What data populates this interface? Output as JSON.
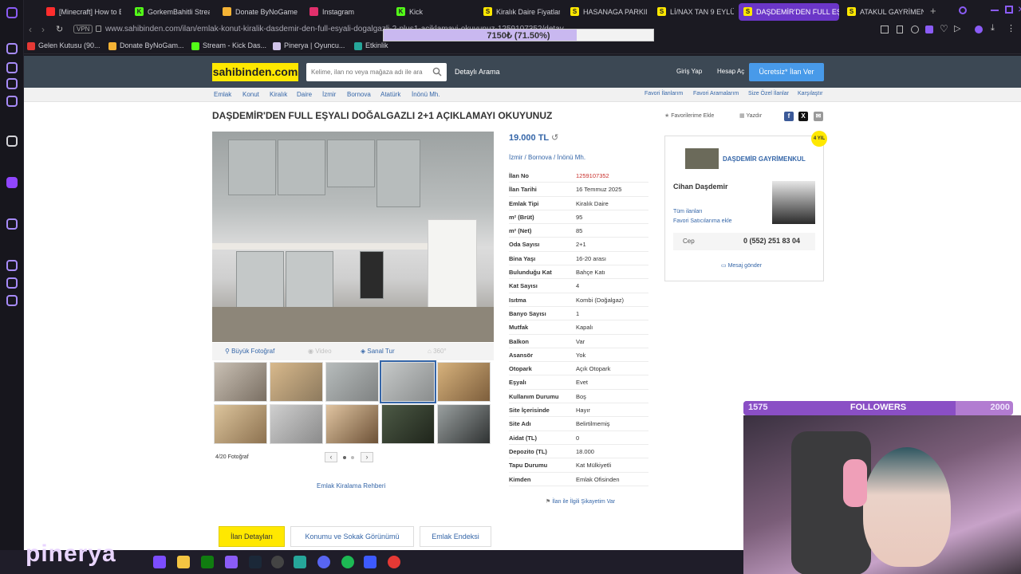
{
  "browser": {
    "tabs": [
      {
        "label": "[Minecraft] How to B",
        "color": "#ff2d2d"
      },
      {
        "label": "GorkemBahitli Strea",
        "color": "#53fc18"
      },
      {
        "label": "Donate ByNoGame",
        "color": "#f5b335"
      },
      {
        "label": "Instagram",
        "color": "#e1306c"
      },
      {
        "label": "Kick",
        "color": "#53fc18"
      },
      {
        "label": "Kiralık Daire Fiyatlar",
        "color": "#ffe800"
      },
      {
        "label": "HASANAGA PARKIN",
        "color": "#ffe800"
      },
      {
        "label": "Lİ/NAX TAN 9 EYLÜ",
        "color": "#ffe800"
      },
      {
        "label": "DAŞDEMİR'DEN FULL EŞ",
        "color": "#ffe800"
      },
      {
        "label": "ATAKUL GAYRİMENK",
        "color": "#ffe800"
      }
    ],
    "tab_letters": [
      "",
      "K",
      "",
      "",
      "K",
      "S",
      "S",
      "S",
      "S",
      "S"
    ],
    "vpn": "VPN",
    "url": "www.sahibinden.com/ilan/emlak-konut-kiralik-dasdemir-den-full-esyali-dogalgazli-2-plus1-aciklamayi-okuyunuz-1259107352/detay",
    "bookmarks": [
      "Gelen Kutusu (90...",
      "Donate ByNoGam...",
      "Stream - Kick Das...",
      "Pinerya | Oyuncu...",
      "Etkinlik"
    ],
    "overlay": {
      "text": "7150₺ (71.50%)",
      "percent": 71.5
    }
  },
  "header": {
    "logo": "sahibinden.com",
    "search_placeholder": "Kelime, ilan no veya mağaza adı ile ara",
    "detailed_search": "Detaylı Arama",
    "login": "Giriş Yap",
    "signup": "Hesap Aç",
    "post_button": "Ücretsiz* İlan Ver"
  },
  "breadcrumb": {
    "items": [
      "Emlak",
      "Konut",
      "Kiralık",
      "Daire",
      "İzmir",
      "Bornova",
      "Atatürk",
      "İnönü Mh."
    ],
    "right_links": [
      "Favori İlanlarım",
      "Favori Aramalarım",
      "Size Özel İlanlar",
      "Karşılaştır"
    ]
  },
  "listing": {
    "title": "DAŞDEMİR'DEN FULL EŞYALI DOĞALGAZLI 2+1 AÇIKLAMAYI OKUYUNUZ",
    "add_favorite": "Favorilerime Ekle",
    "print": "Yazdır",
    "price": "19.000 TL",
    "location": [
      "İzmir",
      "Bornova",
      "İnönü Mh."
    ],
    "photo_tools": {
      "large": "Büyük Fotoğraf",
      "video": "Video",
      "tour": "Sanal Tur",
      "360": "360°"
    },
    "photo_counter": "4/20 Fotoğraf",
    "rent_guide": "Emlak Kiralama Rehberi",
    "complaint": "İlan ile İlgili Şikayetim Var",
    "props": [
      {
        "k": "İlan No",
        "v": "1259107352"
      },
      {
        "k": "İlan Tarihi",
        "v": "16 Temmuz 2025"
      },
      {
        "k": "Emlak Tipi",
        "v": "Kiralık Daire"
      },
      {
        "k": "m² (Brüt)",
        "v": "95"
      },
      {
        "k": "m² (Net)",
        "v": "85"
      },
      {
        "k": "Oda Sayısı",
        "v": "2+1"
      },
      {
        "k": "Bina Yaşı",
        "v": "16-20 arası"
      },
      {
        "k": "Bulunduğu Kat",
        "v": "Bahçe Katı"
      },
      {
        "k": "Kat Sayısı",
        "v": "4"
      },
      {
        "k": "Isıtma",
        "v": "Kombi (Doğalgaz)"
      },
      {
        "k": "Banyo Sayısı",
        "v": "1"
      },
      {
        "k": "Mutfak",
        "v": "Kapalı"
      },
      {
        "k": "Balkon",
        "v": "Var"
      },
      {
        "k": "Asansör",
        "v": "Yok"
      },
      {
        "k": "Otopark",
        "v": "Açık Otopark"
      },
      {
        "k": "Eşyalı",
        "v": "Evet"
      },
      {
        "k": "Kullanım Durumu",
        "v": "Boş"
      },
      {
        "k": "Site İçerisinde",
        "v": "Hayır"
      },
      {
        "k": "Site Adı",
        "v": "Belirtilmemiş"
      },
      {
        "k": "Aidat (TL)",
        "v": "0"
      },
      {
        "k": "Depozito (TL)",
        "v": "18.000"
      },
      {
        "k": "Tapu Durumu",
        "v": "Kat Mülkiyetli"
      },
      {
        "k": "Kimden",
        "v": "Emlak Ofisinden"
      }
    ]
  },
  "seller": {
    "firm": "DAŞDEMİR GAYRİMENKUL",
    "name": "Cihan Daşdemir",
    "all_listings": "Tüm ilanları",
    "add_fav_seller": "Favori Satıcılarıma ekle",
    "phone_label": "Cep",
    "phone": "0 (552) 251 83 04",
    "message": "Mesaj gönder",
    "badge": "4 YIL"
  },
  "bottom_tabs": [
    "İlan Detayları",
    "Konumu ve Sokak Görünümü",
    "Emlak Endeksi"
  ],
  "stream": {
    "followers_current": "1575",
    "followers_label": "FOLLOWERS",
    "followers_goal": "2000",
    "progress": 0.7875,
    "brand": "pinerya"
  }
}
